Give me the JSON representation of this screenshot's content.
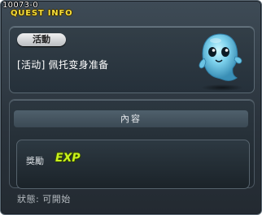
{
  "window": {
    "quest_id": "10073-0",
    "title": "QUEST INFO"
  },
  "quest": {
    "category": "活動",
    "name": "[活动] 佩托变身准备",
    "image_icon": "blue-ghost-icon"
  },
  "content": {
    "header": "內容",
    "reward_label": "獎勵",
    "reward_badge": "EXP"
  },
  "status": {
    "text": "狀態: 可開始"
  },
  "colors": {
    "title": "#f6de3a",
    "exp": "#c9f21c",
    "panel": "#2c3740"
  }
}
